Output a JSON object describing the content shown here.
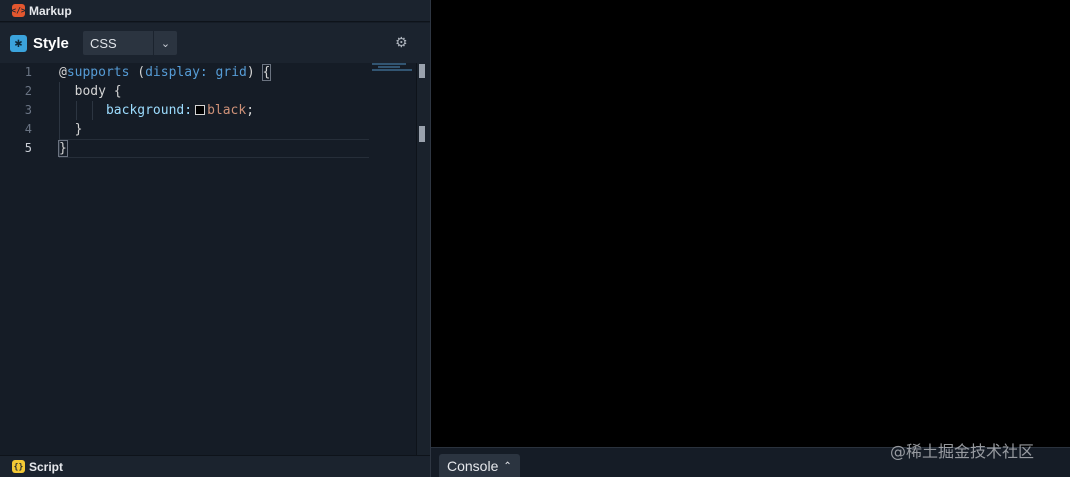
{
  "markup_bar": {
    "title": "Markup",
    "icon": "code-brackets-icon"
  },
  "style_bar": {
    "title": "Style",
    "icon": "asterisk-icon",
    "language": "CSS",
    "settings_icon": "gear-icon"
  },
  "editor": {
    "line_numbers": [
      "1",
      "2",
      "3",
      "4",
      "5"
    ],
    "active_line": "5",
    "lines": {
      "l1": {
        "at": "@",
        "keyword": "supports",
        "paren_open": " (",
        "cond_prop": "display:",
        "cond_value": " grid",
        "paren_close": ") ",
        "brace": "{"
      },
      "l2": {
        "indent": "  ",
        "selector": "body {"
      },
      "l3": {
        "indent": "      ",
        "property": "background:",
        "value": "black",
        "semicolon": ";"
      },
      "l4": {
        "indent": "  ",
        "brace": "}"
      },
      "l5": {
        "brace": "}"
      }
    }
  },
  "script_bar": {
    "title": "Script",
    "icon": "curly-braces-icon"
  },
  "console": {
    "label": "Console",
    "icon": "chevron-up-icon"
  },
  "watermark": "@稀土掘金技术社区",
  "colors": {
    "panel_bg": "#151c26",
    "bar_bg": "#1b232e",
    "preview_bg": "#000000",
    "keyword": "#569cd6",
    "property": "#9cdcfe",
    "value": "#ce9178",
    "markup_badge": "#e3572f",
    "style_badge": "#3ba3dc",
    "script_badge": "#f3c935"
  }
}
